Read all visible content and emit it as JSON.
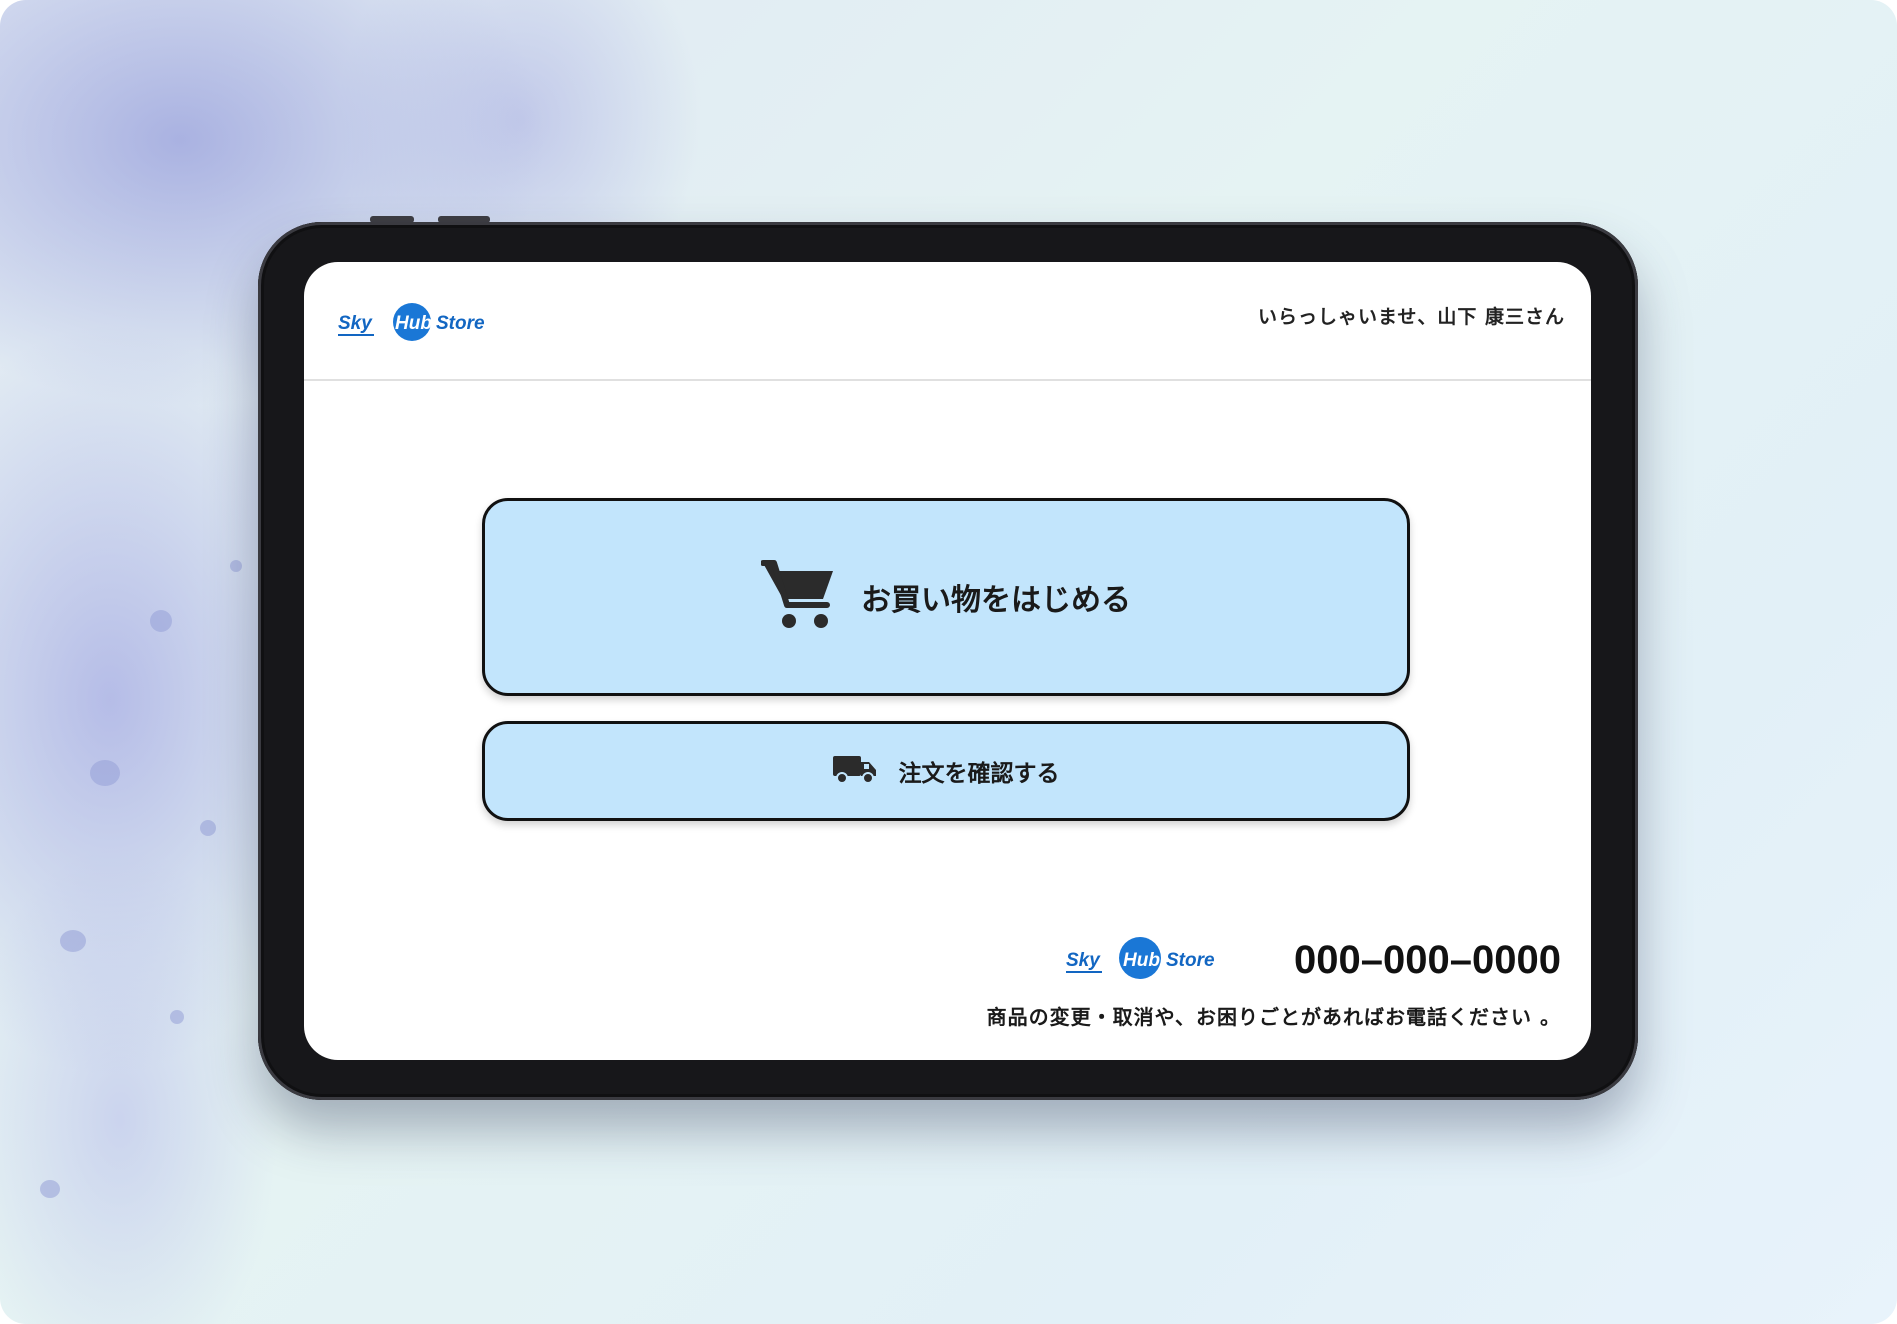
{
  "brand": {
    "logo_part1": "Sky",
    "logo_part2": "Hub",
    "logo_part3": "Store",
    "color_blue": "#1266c2",
    "color_circle": "#1a77d6"
  },
  "header": {
    "greeting": "いらっしゃいませ、山下 康三さん"
  },
  "actions": {
    "start_shopping": {
      "label": "お買い物をはじめる",
      "icon": "shopping-cart-icon"
    },
    "check_order": {
      "label": "注文を確認する",
      "icon": "delivery-truck-icon"
    }
  },
  "footer": {
    "phone": "000–000–0000",
    "note": "商品の変更・取消や、お困りごとがあればお電話ください 。"
  },
  "colors": {
    "button_bg": "#c2e5fc",
    "button_border": "#111111",
    "screen_bg": "#ffffff"
  }
}
